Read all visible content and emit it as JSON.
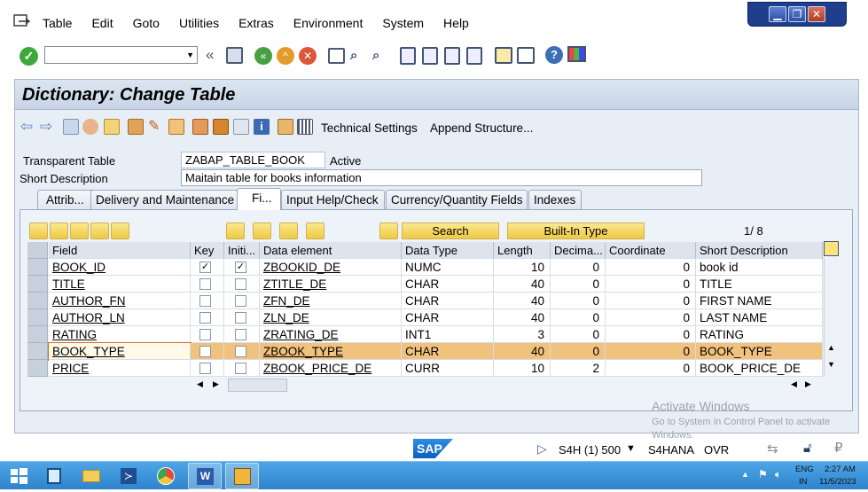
{
  "menubar": {
    "items": [
      "Table",
      "Edit",
      "Goto",
      "Utilities",
      "Extras",
      "Environment",
      "System",
      "Help"
    ]
  },
  "title": "Dictionary: Change Table",
  "app_toolbar": {
    "technical_settings": "Technical Settings",
    "append_structure": "Append Structure..."
  },
  "header": {
    "table_type_label": "Transparent Table",
    "table_name": "ZABAP_TABLE_BOOK",
    "status": "Active",
    "short_desc_label": "Short Description",
    "short_desc": "Maitain table for books information"
  },
  "tabs": [
    "Attrib...",
    "Delivery and Maintenance",
    "Fi...",
    "Input Help/Check",
    "Currency/Quantity Fields",
    "Indexes"
  ],
  "table_toolbar": {
    "search": "Search",
    "builtin": "Built-In Type",
    "page": "1/ 8"
  },
  "columns": [
    "Field",
    "Key",
    "Initi...",
    "Data element",
    "Data Type",
    "Length",
    "Decima...",
    "Coordinate",
    "Short Description"
  ],
  "rows": [
    {
      "field": "BOOK_ID",
      "key": true,
      "init": true,
      "element": "ZBOOKID_DE",
      "type": "NUMC",
      "length": "10",
      "dec": "0",
      "coord": "0",
      "desc": "book id"
    },
    {
      "field": "TITLE",
      "key": false,
      "init": false,
      "element": "ZTITLE_DE",
      "type": "CHAR",
      "length": "40",
      "dec": "0",
      "coord": "0",
      "desc": "TITLE"
    },
    {
      "field": "AUTHOR_FN",
      "key": false,
      "init": false,
      "element": "ZFN_DE",
      "type": "CHAR",
      "length": "40",
      "dec": "0",
      "coord": "0",
      "desc": "FIRST NAME"
    },
    {
      "field": "AUTHOR_LN",
      "key": false,
      "init": false,
      "element": "ZLN_DE",
      "type": "CHAR",
      "length": "40",
      "dec": "0",
      "coord": "0",
      "desc": "LAST NAME"
    },
    {
      "field": "RATING",
      "key": false,
      "init": false,
      "element": "ZRATING_DE",
      "type": "INT1",
      "length": "3",
      "dec": "0",
      "coord": "0",
      "desc": "RATING"
    },
    {
      "field": "BOOK_TYPE",
      "key": false,
      "init": false,
      "element": "ZBOOK_TYPE",
      "type": "CHAR",
      "length": "40",
      "dec": "0",
      "coord": "0",
      "desc": "BOOK_TYPE"
    },
    {
      "field": "PRICE",
      "key": false,
      "init": false,
      "element": "ZBOOK_PRICE_DE",
      "type": "CURR",
      "length": "10",
      "dec": "2",
      "coord": "0",
      "desc": "BOOK_PRICE_DE"
    }
  ],
  "status": {
    "system": "S4H (1) 500",
    "server": "S4HANA",
    "mode": "OVR",
    "logo": "SAP"
  },
  "watermark": {
    "line1": "Activate Windows",
    "line2": "Go to System in Control Panel to activate",
    "line3": "Windows."
  },
  "tray": {
    "lang1": "ENG",
    "lang2": "IN",
    "time": "2:27 AM",
    "date": "11/5/2023"
  },
  "colors": {
    "selected_row": "#f1c27d",
    "title_bar": "#c8d5e6",
    "taskbar": "#2f83cb"
  }
}
